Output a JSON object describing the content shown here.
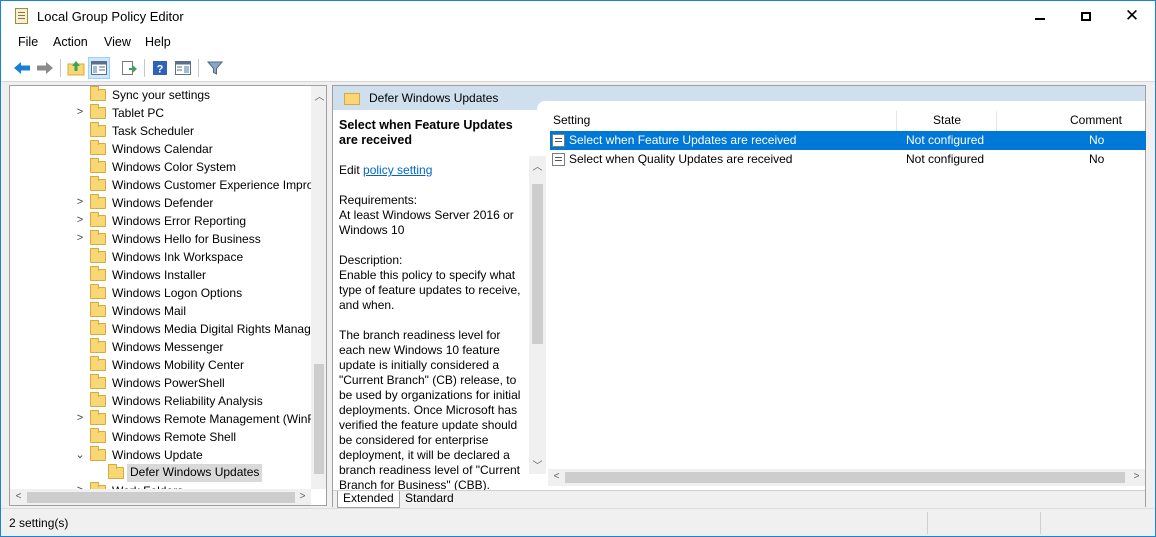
{
  "window": {
    "title": "Local Group Policy Editor",
    "minimize": "▬",
    "maximize": "▢",
    "close": "✕"
  },
  "menu": [
    "File",
    "Action",
    "View",
    "Help"
  ],
  "toolbar": {
    "icons": [
      "back-icon",
      "forward-icon",
      "up-folder-icon",
      "show-hide-tree-icon",
      "export-list-icon",
      "help-icon",
      "properties-view-icon",
      "filter-icon"
    ]
  },
  "tree": {
    "items": [
      {
        "label": "Sync your settings",
        "arrow": ""
      },
      {
        "label": "Tablet PC",
        "arrow": ">"
      },
      {
        "label": "Task Scheduler",
        "arrow": ""
      },
      {
        "label": "Windows Calendar",
        "arrow": ""
      },
      {
        "label": "Windows Color System",
        "arrow": ""
      },
      {
        "label": "Windows Customer Experience Improvement Program",
        "arrow": ""
      },
      {
        "label": "Windows Defender",
        "arrow": ">"
      },
      {
        "label": "Windows Error Reporting",
        "arrow": ">"
      },
      {
        "label": "Windows Hello for Business",
        "arrow": ">"
      },
      {
        "label": "Windows Ink Workspace",
        "arrow": ""
      },
      {
        "label": "Windows Installer",
        "arrow": ""
      },
      {
        "label": "Windows Logon Options",
        "arrow": ""
      },
      {
        "label": "Windows Mail",
        "arrow": ""
      },
      {
        "label": "Windows Media Digital Rights Management",
        "arrow": ""
      },
      {
        "label": "Windows Messenger",
        "arrow": ""
      },
      {
        "label": "Windows Mobility Center",
        "arrow": ""
      },
      {
        "label": "Windows PowerShell",
        "arrow": ""
      },
      {
        "label": "Windows Reliability Analysis",
        "arrow": ""
      },
      {
        "label": "Windows Remote Management (WinRM)",
        "arrow": ">"
      },
      {
        "label": "Windows Remote Shell",
        "arrow": ""
      },
      {
        "label": "Windows Update",
        "arrow": "⌄"
      },
      {
        "label": "Defer Windows Updates",
        "arrow": "",
        "child": true,
        "selected": true
      },
      {
        "label": "Work Folders",
        "arrow": ">"
      }
    ]
  },
  "main": {
    "folder_title": "Defer Windows Updates",
    "description": {
      "title": "Select when Feature Updates are received",
      "edit_prefix": "Edit",
      "edit_link": "policy setting",
      "requirements_label": "Requirements:",
      "requirements": "At least Windows Server 2016 or Windows 10",
      "description_label": "Description:",
      "text1": "Enable this policy to specify what type of feature updates to receive, and when.",
      "text2": "The branch readiness level for each new Windows 10 feature update is initially considered a \"Current Branch\" (CB) release, to be used by organizations for initial deployments. Once Microsoft has verified the feature update should be considered for enterprise deployment, it will be declared a branch readiness level of \"Current Branch for Business\" (CBB)."
    },
    "columns": [
      "Setting",
      "State",
      "Comment"
    ],
    "rows": [
      {
        "setting": "Select when Feature Updates are received",
        "state": "Not configured",
        "comment": "No"
      },
      {
        "setting": "Select when Quality Updates are received",
        "state": "Not configured",
        "comment": "No"
      }
    ],
    "tabs": [
      "Extended",
      "Standard"
    ]
  },
  "status": {
    "text": "2 setting(s)"
  },
  "colors": {
    "selection": "#0078d7",
    "header_band": "#cfdfee",
    "link": "#0066cc"
  }
}
